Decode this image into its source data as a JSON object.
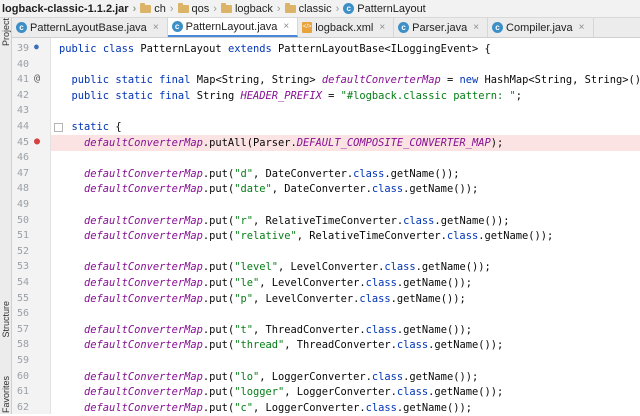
{
  "breadcrumb": [
    {
      "label": "logback-classic-1.1.2.jar",
      "icon": "none"
    },
    {
      "label": "ch",
      "icon": "folder-icon"
    },
    {
      "label": "qos",
      "icon": "folder-icon"
    },
    {
      "label": "logback",
      "icon": "folder-icon"
    },
    {
      "label": "classic",
      "icon": "folder-icon"
    },
    {
      "label": "PatternLayout",
      "icon": "class-icon"
    }
  ],
  "tabs": [
    {
      "label": "PatternLayoutBase.java",
      "icon": "class-icon",
      "active": false
    },
    {
      "label": "PatternLayout.java",
      "icon": "class-icon",
      "active": true
    },
    {
      "label": "logback.xml",
      "icon": "xml-icon",
      "active": false
    },
    {
      "label": "Parser.java",
      "icon": "class-icon",
      "active": false
    },
    {
      "label": "Compiler.java",
      "icon": "class-icon",
      "active": false
    }
  ],
  "side_labels": [
    "Project",
    "Structure",
    "Favorites"
  ],
  "code_lines": [
    {
      "n": "39",
      "text": "public class PatternLayout extends PatternLayoutBase<ILoggingEvent> {",
      "gutter": "implements-icon"
    },
    {
      "n": "40",
      "text": ""
    },
    {
      "n": "41",
      "text": "  public static final Map<String, String> defaultConverterMap = new HashMap<String, String>();",
      "gutter": "annotation-icon"
    },
    {
      "n": "42",
      "text": "  public static final String HEADER_PREFIX = \"#logback.classic pattern: \";"
    },
    {
      "n": "43",
      "text": ""
    },
    {
      "n": "44",
      "text": "  static {",
      "fold": true
    },
    {
      "n": "45",
      "text": "    defaultConverterMap.putAll(Parser.DEFAULT_COMPOSITE_CONVERTER_MAP);",
      "gutter": "breakpoint-icon",
      "highlight": true
    },
    {
      "n": "46",
      "text": ""
    },
    {
      "n": "47",
      "text": "    defaultConverterMap.put(\"d\", DateConverter.class.getName());"
    },
    {
      "n": "48",
      "text": "    defaultConverterMap.put(\"date\", DateConverter.class.getName());"
    },
    {
      "n": "49",
      "text": ""
    },
    {
      "n": "50",
      "text": "    defaultConverterMap.put(\"r\", RelativeTimeConverter.class.getName());"
    },
    {
      "n": "51",
      "text": "    defaultConverterMap.put(\"relative\", RelativeTimeConverter.class.getName());"
    },
    {
      "n": "52",
      "text": ""
    },
    {
      "n": "53",
      "text": "    defaultConverterMap.put(\"level\", LevelConverter.class.getName());"
    },
    {
      "n": "54",
      "text": "    defaultConverterMap.put(\"le\", LevelConverter.class.getName());"
    },
    {
      "n": "55",
      "text": "    defaultConverterMap.put(\"p\", LevelConverter.class.getName());"
    },
    {
      "n": "56",
      "text": ""
    },
    {
      "n": "57",
      "text": "    defaultConverterMap.put(\"t\", ThreadConverter.class.getName());"
    },
    {
      "n": "58",
      "text": "    defaultConverterMap.put(\"thread\", ThreadConverter.class.getName());"
    },
    {
      "n": "59",
      "text": ""
    },
    {
      "n": "60",
      "text": "    defaultConverterMap.put(\"lo\", LoggerConverter.class.getName());"
    },
    {
      "n": "61",
      "text": "    defaultConverterMap.put(\"logger\", LoggerConverter.class.getName());"
    },
    {
      "n": "62",
      "text": "    defaultConverterMap.put(\"c\", LoggerConverter.class.getName());"
    }
  ],
  "colors": {
    "keyword": "#0033b3",
    "field": "#871094",
    "string": "#067d17",
    "highlight": "#fbe3e4",
    "accent": "#4a88d8"
  }
}
